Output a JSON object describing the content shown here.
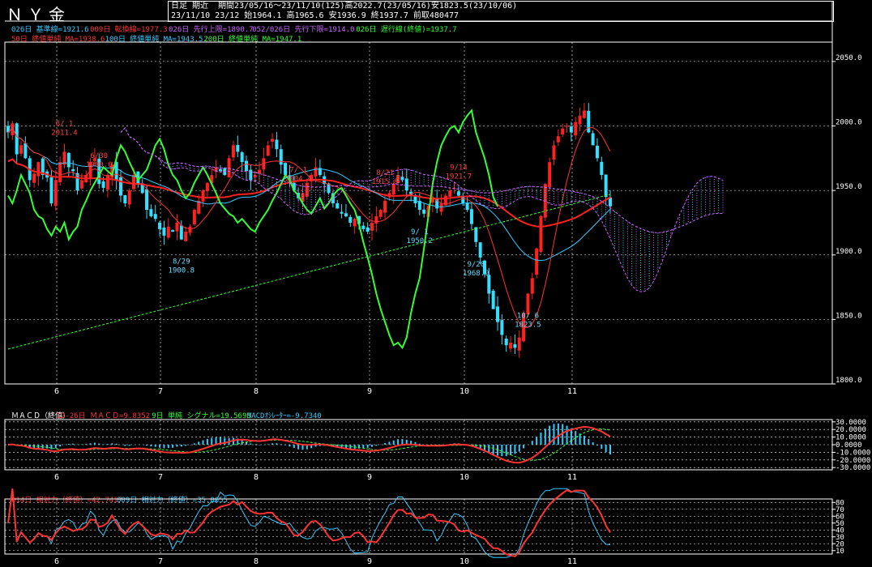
{
  "header": {
    "title": "ＮＹ金",
    "row1": "日足 期近  期間23/05/16～23/11/10(125)高2022.7(23/05/16)安1823.5(23/10/06)",
    "row2": "23/11/10 23/12 始1964.1 高1965.6 安1936.9 終1937.7 前取480477"
  },
  "legend_main": [
    {
      "text": "026日 基準線=1921.6",
      "color": "#33ccff"
    },
    {
      "text": "009日 転換線=1977.3",
      "color": "#ff3333"
    },
    {
      "text": "026日 先行上限=1890.7",
      "color": "#cc66ff"
    },
    {
      "text": "052/026日 先行下限=1914.0",
      "color": "#cc66ff"
    },
    {
      "text": "026日 遅行線(終値)=1937.7",
      "color": "#33ff33"
    },
    {
      "text": "50日 終値単純 MA=1938.6",
      "color": "#ff3333"
    },
    {
      "text": "100日 終値単純 MA=1943.5",
      "color": "#33ccff"
    },
    {
      "text": "200日 終値単純 MA=1947.1",
      "color": "#33ff33"
    }
  ],
  "legend_macd": [
    {
      "text": "ＭＡＣＤ（終値）",
      "color": "#ffffff"
    },
    {
      "text": "12-26日 ＭＡＣＤ=9.8352",
      "color": "#ff3333"
    },
    {
      "text": "9日 単純 シグナル=19.5693",
      "color": "#33ff33"
    },
    {
      "text": "MACDｵｼﾚｰﾀｰ=-9.7340",
      "color": "#33ccff"
    }
  ],
  "legend_rsi": [
    {
      "text": "014日 相対力（終値）=42.7417",
      "color": "#ff3333"
    },
    {
      "text": "009日 相対力（終値）=35.0655",
      "color": "#33ccff"
    }
  ],
  "colors": {
    "up": "#ff2020",
    "down": "#33e0ff",
    "kijun": "#33ccff",
    "tenkan": "#ff3333",
    "chikou": "#33ff33",
    "ma50": "#ff2020",
    "ma100": "#33ccff",
    "ma200": "#33ff33",
    "cloud": "#cc66ff",
    "grid": "#ffffff",
    "axis": "#ffffff"
  },
  "chart_data": [
    {
      "type": "candlestick",
      "x_ticks": [
        "6",
        "7",
        "8",
        "9",
        "10",
        "11"
      ],
      "y_ticks": [
        "2050.0",
        "2000.0",
        "1950.0",
        "1900.0",
        "1850.0",
        "1800.0"
      ],
      "ylim": [
        1800,
        2065
      ],
      "annotations": [
        {
          "label": "6/ 1",
          "value": "2011.4",
          "idx": 13
        },
        {
          "label": "6/30",
          "value": "1900.0",
          "idx": 21
        },
        {
          "label": "8/29",
          "value": "1900.8",
          "idx": 40
        },
        {
          "label": "7/ 1",
          "value": "2004.4",
          "idx": 67
        },
        {
          "label": "8/21",
          "value": "1915.8",
          "idx": 87
        },
        {
          "label": "9/ 1",
          "value": "1950.2",
          "idx": 95
        },
        {
          "label": "9/14",
          "value": "1921.7",
          "idx": 104
        },
        {
          "label": "9/20",
          "value": "1968.9",
          "idx": 108
        },
        {
          "label": "10/ 6",
          "value": "1823.5",
          "idx": 120
        }
      ],
      "closes": [
        1995,
        2002,
        1978,
        1985,
        1975,
        1958,
        1963,
        1972,
        1962,
        1960,
        1940,
        1958,
        1972,
        1980,
        1968,
        1965,
        1950,
        1958,
        1962,
        1972,
        1975,
        1955,
        1952,
        1962,
        1970,
        1958,
        1946,
        1940,
        1950,
        1962,
        1955,
        1948,
        1935,
        1930,
        1928,
        1920,
        1915,
        1922,
        1918,
        1925,
        1912,
        1918,
        1922,
        1935,
        1942,
        1950,
        1956,
        1962,
        1968,
        1965,
        1962,
        1975,
        1985,
        1980,
        1972,
        1965,
        1958,
        1962,
        1966,
        1975,
        1985,
        1990,
        1982,
        1970,
        1962,
        1958,
        1950,
        1944,
        1948,
        1956,
        1962,
        1968,
        1962,
        1955,
        1948,
        1940,
        1936,
        1932,
        1930,
        1925,
        1928,
        1924,
        1920,
        1918,
        1925,
        1930,
        1935,
        1942,
        1948,
        1955,
        1962,
        1958,
        1950,
        1946,
        1940,
        1935,
        1932,
        1938,
        1944,
        1936,
        1940,
        1946,
        1950,
        1952,
        1946,
        1940,
        1935,
        1924,
        1910,
        1898,
        1885,
        1870,
        1858,
        1848,
        1838,
        1830,
        1832,
        1828,
        1836,
        1855,
        1870,
        1882,
        1905,
        1930,
        1955,
        1972,
        1985,
        1992,
        1998,
        2000,
        1995,
        2003,
        2008,
        2012,
        1995,
        1985,
        1975,
        1962,
        1945,
        1937.7
      ],
      "kijun": [
        1921.6
      ],
      "tenkan": [
        1977.3
      ]
    },
    {
      "type": "line",
      "name": "MACD",
      "y_ticks": [
        "30.0000",
        "20.0000",
        "10.0000",
        "0.0000",
        "-10.0000",
        "-20.0000",
        "-30.0000"
      ],
      "ylim": [
        -33,
        33
      ]
    },
    {
      "type": "line",
      "name": "RSI",
      "y_ticks": [
        "80",
        "70",
        "60",
        "50",
        "40",
        "30",
        "20",
        "10"
      ],
      "ylim": [
        5,
        85
      ]
    }
  ]
}
